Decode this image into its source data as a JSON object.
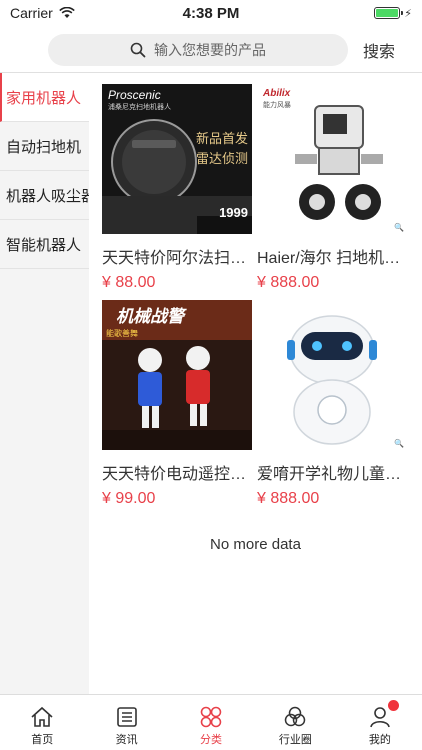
{
  "status": {
    "carrier": "Carrier",
    "time": "4:38 PM"
  },
  "search": {
    "placeholder": "输入您想要的产品",
    "button": "搜索"
  },
  "sidebar": {
    "items": [
      {
        "label": "家用机器人",
        "active": true
      },
      {
        "label": "自动扫地机",
        "active": false
      },
      {
        "label": "机器人吸尘器",
        "active": false
      },
      {
        "label": "智能机器人",
        "active": false
      }
    ]
  },
  "products": [
    {
      "title": "天天特价阿尔法扫地机器人",
      "price": "¥ 88.00",
      "image": {
        "brand": "Proscenic",
        "sub": "浦桑尼克扫地机器人",
        "banner1": "新品首发",
        "banner2": "雷达侦测",
        "price_tag": "1999"
      }
    },
    {
      "title": "Haier/海尔 扫地机器人",
      "price": "¥ 888.00",
      "image": {
        "brand": "Abilix",
        "sub": "能力风暴"
      }
    },
    {
      "title": "天天特价电动遥控机器人",
      "price": "¥ 99.00",
      "image": {
        "banner": "机械战警",
        "sub": "能歌善舞"
      }
    },
    {
      "title": "爱唷开学礼物儿童机器人",
      "price": "¥ 888.00",
      "image": {}
    }
  ],
  "footer_note": "No more data",
  "tabbar": {
    "items": [
      {
        "label": "首页",
        "icon": "home-icon"
      },
      {
        "label": "资讯",
        "icon": "news-icon"
      },
      {
        "label": "分类",
        "icon": "category-icon",
        "active": true
      },
      {
        "label": "行业圈",
        "icon": "circles-icon"
      },
      {
        "label": "我的",
        "icon": "profile-icon"
      }
    ]
  },
  "colors": {
    "accent": "#e8414a",
    "battery": "#4cd964"
  }
}
